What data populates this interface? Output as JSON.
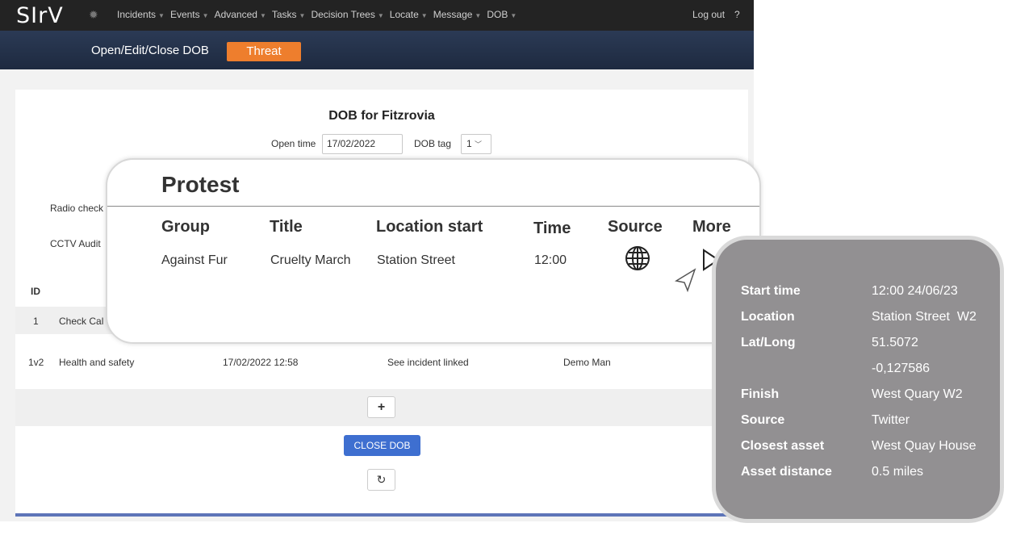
{
  "app": {
    "logo": "SIrV"
  },
  "nav": {
    "items": [
      "Incidents",
      "Events",
      "Advanced",
      "Tasks",
      "Decision Trees",
      "Locate",
      "Message",
      "DOB"
    ],
    "logout": "Log out",
    "help": "?"
  },
  "subheader": {
    "title": "Open/Edit/Close DOB",
    "threat_button": "Threat"
  },
  "dob": {
    "title": "DOB for Fitzrovia",
    "open_time_label": "Open time",
    "open_time_value": "17/02/2022",
    "tag_label": "DOB tag",
    "tag_value": "1",
    "radio_check": "Radio check",
    "cctv_audit": "CCTV Audit",
    "id_header": "ID",
    "rows": [
      {
        "id": "1",
        "task": "Check Cal",
        "time": "",
        "note": "",
        "user": ""
      },
      {
        "id": "1v2",
        "task": "Health and safety",
        "time": "17/02/2022 12:58",
        "note": "See incident linked",
        "user": "Demo Man"
      }
    ],
    "add_button": "+",
    "close_button": "CLOSE DOB",
    "refresh_icon": "refresh-icon"
  },
  "protest": {
    "title": "Protest",
    "headers": [
      "Group",
      "Title",
      "Location start",
      "Time",
      "Source",
      "More"
    ],
    "row": {
      "group": "Against Fur",
      "title": "Cruelty March",
      "location": "Station Street",
      "time": "12:00",
      "source_icon": "globe-icon",
      "more_icon": "play-icon"
    }
  },
  "details": {
    "rows": [
      {
        "label": "Start time",
        "value": "12:00 24/06/23"
      },
      {
        "label": "Location",
        "value": "Station Street  W2"
      },
      {
        "label": "Lat/Long",
        "value": "51.5072"
      },
      {
        "label": "",
        "value": "-0,127586"
      },
      {
        "label": "Finish",
        "value": "West Quary W2"
      },
      {
        "label": "Source",
        "value": "Twitter"
      },
      {
        "label": "Closest asset",
        "value": "West Quay House"
      },
      {
        "label": "Asset distance",
        "value": "0.5 miles"
      }
    ]
  },
  "colors": {
    "nav_bg": "#232323",
    "subheader_bg": "#2b3a55",
    "threat": "#ee7e2d",
    "primary_button": "#3e6fd0",
    "panel_bg": "#929092"
  }
}
